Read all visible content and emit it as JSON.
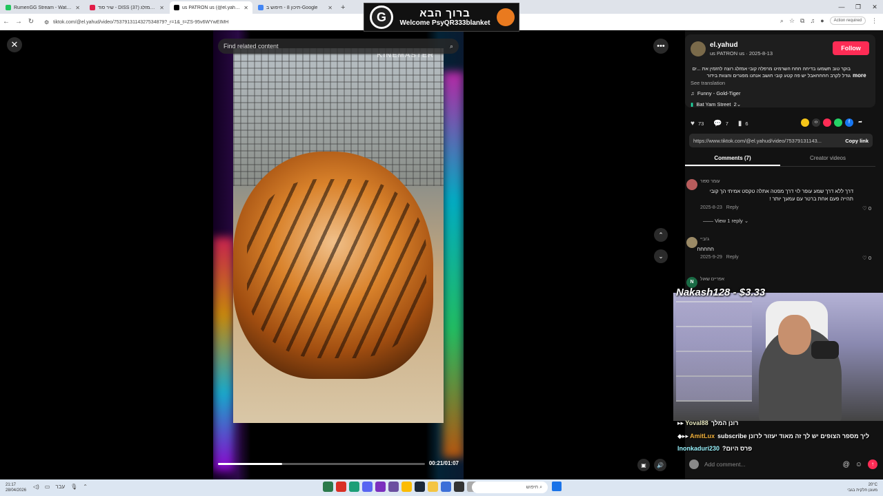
{
  "browser": {
    "tabs": [
      {
        "title": "RumenGG Stream - Watch Live",
        "color": "#22c55e",
        "active": false
      },
      {
        "title": "שיר סוד - DISS קובי אמזלג (37)",
        "color": "#e11d48",
        "active": false
      },
      {
        "title": "us PATRON us (@el.yahud)",
        "color": "#000000",
        "active": true
      },
      {
        "title": "תיכון 8 - חיפוש ב-Google",
        "color": "#4285f4",
        "active": false
      }
    ],
    "url": "tiktok.com/@el.yahud/video/7537913114327534879?_r=1&_t=ZS-95v6WYwEIMH",
    "action_required": "Action required"
  },
  "banner": {
    "hebrew": "ברוך הבא",
    "welcome": "Welcome PsyQR333blanket",
    "logo_letter": "G"
  },
  "player": {
    "search_placeholder": "Find related content",
    "watermark": "KINEMASTER",
    "time": "00:21/01:07",
    "progress": 0.31
  },
  "post": {
    "author": "el.yahud",
    "subtitle": "us PATRON us · 2025-8-13",
    "follow_label": "Follow",
    "description": "בוקר טוב תשמעו בדיחה חחח השרמיט מרפלה קובי אמזלג רוצה להזמין את ...ים גודל לקרב חחחחאבל יש פה קטע קובי חושב אנחנו מפגרים והצוות בידור",
    "more_label": "more",
    "see_translation": "See translation",
    "music": "Funny - Gold-Tiger",
    "location": "Bat Yam Street",
    "location_count": "2",
    "likes": "73",
    "comments": "7",
    "saves": "6",
    "link": "https://www.tiktok.com/@el.yahud/video/75379131143...",
    "copy_link": "Copy link"
  },
  "tabs": {
    "comments": "Comments (7)",
    "creator": "Creator videos"
  },
  "comments": [
    {
      "name": "עומר ספור",
      "text": "דרך ללא דרך שמע עופר לוי דרך מפטה אתלה טקסט אמיתי הך קובי תהייה פעם אחת ברטר עם עמעך יותר !",
      "date": "2025-8-23",
      "reply": "Reply",
      "likes": "0",
      "color": "#b85c5c"
    },
    {
      "name": "ג'וביי",
      "text": "חחחחח",
      "date": "2025-9-29",
      "reply": "Reply",
      "likes": "0",
      "color": "#9b8a66"
    },
    {
      "name": "אפריים שאול",
      "avatar_letter": "N",
      "color": "#1a6b45"
    }
  ],
  "view_replies": "View 1 reply",
  "stream": {
    "donation": "Nakash128 - $3.33",
    "chat": [
      {
        "user": "Yoval88",
        "msg": "רונן המלך",
        "cls": "u1"
      },
      {
        "user": "AmitLux",
        "msg": "subscribe ליך מספר הצופים יש לך זה מאוד יעזור לרונן",
        "cls": "u2"
      },
      {
        "user": "Inonkaduri230",
        "msg": "?פרס היום",
        "cls": "u3"
      }
    ]
  },
  "add_comment_placeholder": "Add comment...",
  "taskbar": {
    "time": "21:17",
    "date": "28/04/2026",
    "lang": "עבר",
    "search": "חיפוש",
    "temp": "20°C",
    "weather": "מעונן חלקית בגבי"
  }
}
